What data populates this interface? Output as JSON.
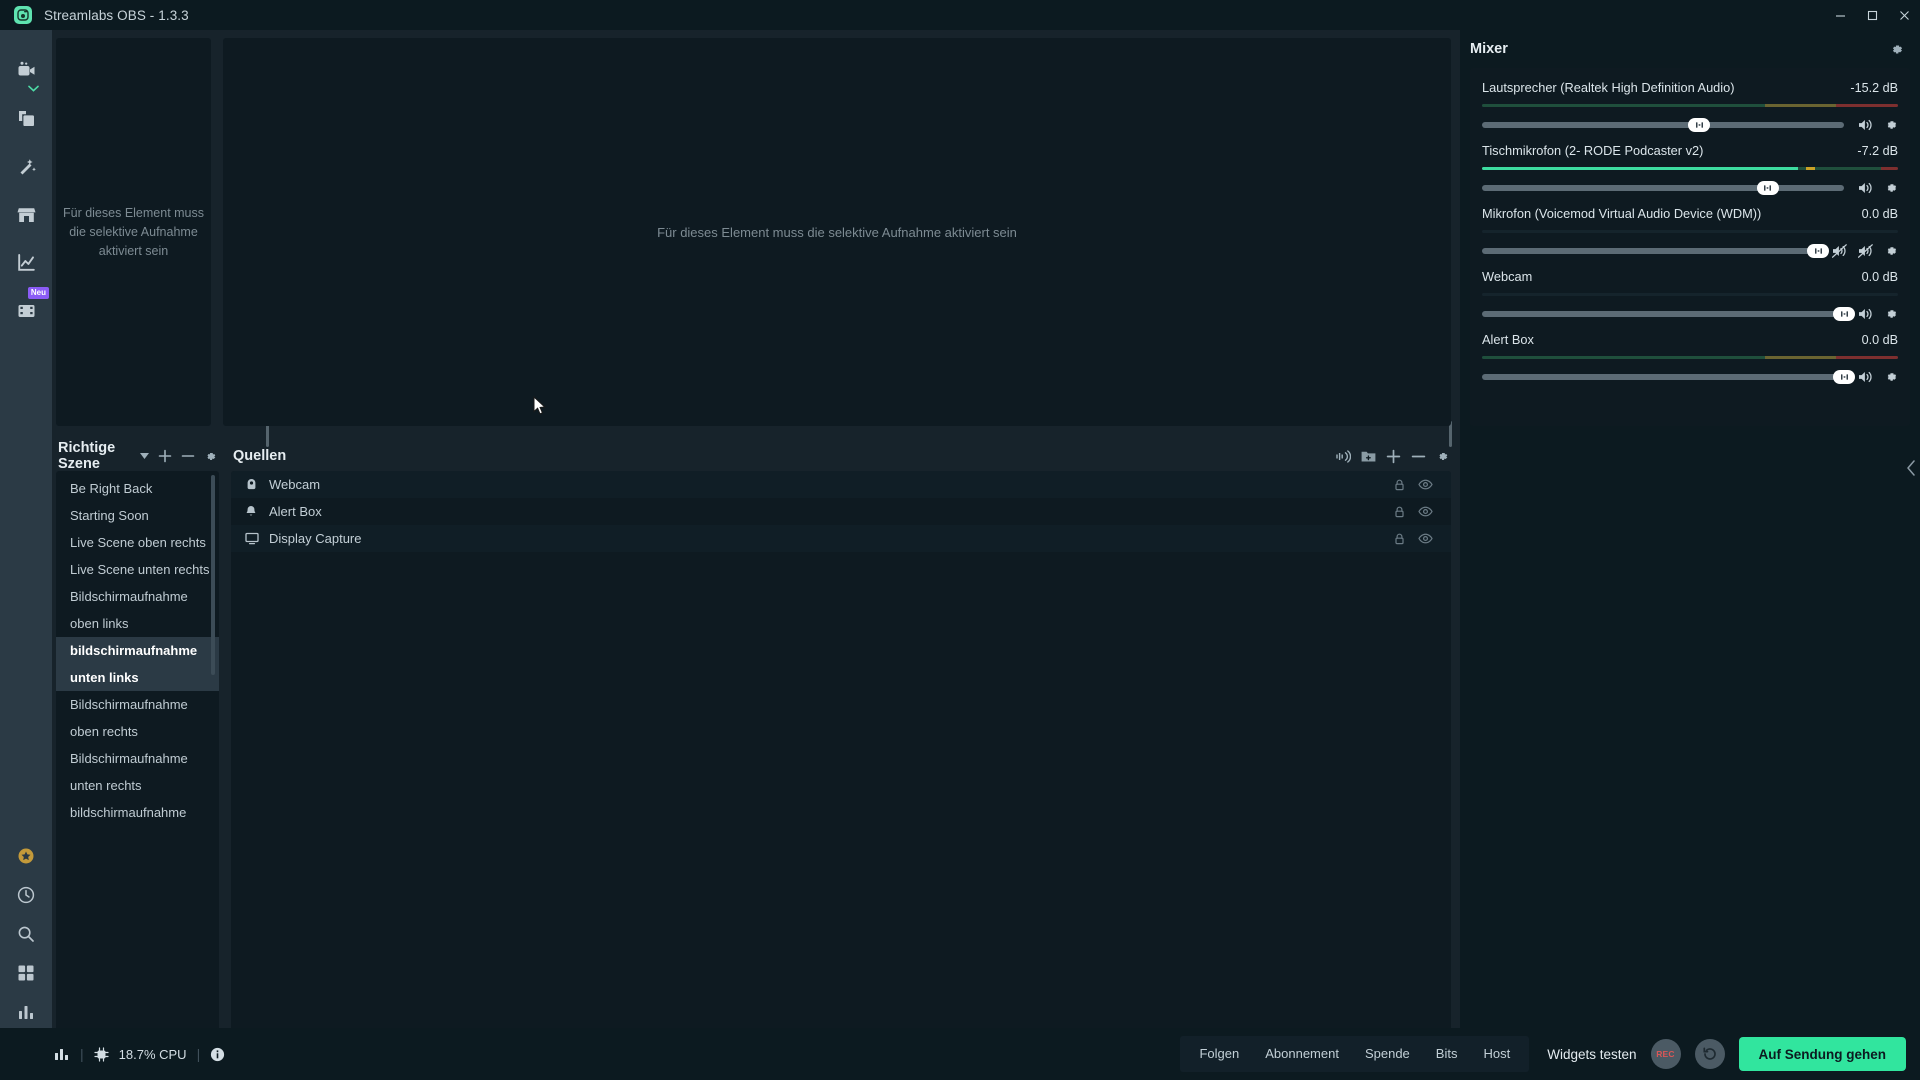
{
  "titlebar": {
    "title": "Streamlabs OBS - 1.3.3",
    "logo_icon": "streamlabs-logo-icon",
    "minimize_label": "–",
    "maximize_label": "□",
    "close_label": "×"
  },
  "rail": {
    "items": [
      {
        "name": "editor",
        "icon": "video-camera-icon",
        "badge": ""
      },
      {
        "name": "themes",
        "icon": "layers-copy-icon",
        "badge": ""
      },
      {
        "name": "alertbox",
        "icon": "magic-wand-icon",
        "badge": ""
      },
      {
        "name": "store",
        "icon": "store-icon",
        "badge": ""
      },
      {
        "name": "dashboard",
        "icon": "chart-line-icon",
        "badge": ""
      },
      {
        "name": "highlighter",
        "icon": "film-icon",
        "badge": "Neu"
      }
    ],
    "bottom_items": [
      {
        "name": "prime",
        "icon": "prime-star-icon"
      },
      {
        "name": "recent-events",
        "icon": "clock-icon"
      },
      {
        "name": "search",
        "icon": "search-icon"
      },
      {
        "name": "layout-editor",
        "icon": "grid-icon"
      },
      {
        "name": "stats",
        "icon": "bars-icon"
      },
      {
        "name": "settings",
        "icon": "gear-icon"
      }
    ]
  },
  "preview": {
    "left_placeholder": "Für dieses Element muss die selektive Aufnahme aktiviert sein",
    "main_placeholder": "Für dieses Element muss die selektive Aufnahme aktiviert sein"
  },
  "scenes": {
    "title": "Richtige Szene",
    "header_icons": [
      "chevron-down-icon",
      "plus-icon",
      "minus-icon",
      "gear-icon"
    ],
    "items": [
      {
        "label": "Be Right Back",
        "selected": false
      },
      {
        "label": "Starting Soon",
        "selected": false
      },
      {
        "label": "Live Scene oben rechts",
        "selected": false
      },
      {
        "label": "Live Scene unten rechts",
        "selected": false
      },
      {
        "label": "Bildschirmaufnahme",
        "selected": false
      },
      {
        "label": "oben links",
        "selected": false
      },
      {
        "label": "bildschirmaufnahme",
        "selected": true
      },
      {
        "label": "unten links",
        "selected": true
      },
      {
        "label": "Bildschirmaufnahme",
        "selected": false
      },
      {
        "label": "oben rechts",
        "selected": false
      },
      {
        "label": "Bildschirmaufnahme",
        "selected": false
      },
      {
        "label": "unten rechts",
        "selected": false
      },
      {
        "label": "bildschirmaufnahme",
        "selected": false
      }
    ]
  },
  "sources": {
    "title": "Quellen",
    "header_icons": [
      "audio-mixer-icon",
      "add-folder-icon",
      "plus-icon",
      "minus-icon",
      "gear-icon"
    ],
    "items": [
      {
        "label": "Webcam",
        "icon": "camera-icon"
      },
      {
        "label": "Alert Box",
        "icon": "bell-icon"
      },
      {
        "label": "Display Capture",
        "icon": "monitor-icon"
      }
    ],
    "row_icons": [
      "lock-icon",
      "eye-icon"
    ]
  },
  "mixer": {
    "title": "Mixer",
    "gear_icon": "gear-icon",
    "channels": [
      {
        "name": "Lautsprecher (Realtek High Definition Audio)",
        "db": "-15.2 dB",
        "meter_pct": 100,
        "meter_style": "idle",
        "volume_pct": 60,
        "muted": false,
        "icons": [
          "volume-icon",
          "gear-icon"
        ]
      },
      {
        "name": "Tischmikrofon (2- RODE Podcaster v2)",
        "db": "-7.2 dB",
        "meter_pct": 76,
        "meter_style": "active",
        "volume_pct": 79,
        "muted": false,
        "icons": [
          "volume-icon",
          "gear-icon"
        ]
      },
      {
        "name": "Mikrofon (Voicemod Virtual Audio Device (WDM))",
        "db": "0.0 dB",
        "meter_pct": 0,
        "meter_style": "none",
        "volume_pct": 100,
        "muted": true,
        "icons": [
          "volume-muted-icon",
          "gear-icon"
        ]
      },
      {
        "name": "Webcam",
        "db": "0.0 dB",
        "meter_pct": 0,
        "meter_style": "none",
        "volume_pct": 100,
        "muted": false,
        "icons": [
          "volume-icon",
          "gear-icon"
        ]
      },
      {
        "name": "Alert Box",
        "db": "0.0 dB",
        "meter_pct": 100,
        "meter_style": "idle",
        "volume_pct": 100,
        "muted": false,
        "icons": [
          "volume-icon",
          "gear-icon"
        ]
      }
    ]
  },
  "statusbar": {
    "perf_icon": "bars-icon",
    "cpu_icon": "cpu-icon",
    "cpu": "18.7% CPU",
    "info_icon": "info-icon",
    "separator": "|",
    "tabs": [
      "Folgen",
      "Abonnement",
      "Spende",
      "Bits",
      "Host"
    ],
    "widgets_label": "Widgets testen",
    "rec_label": "REC",
    "replay_icon": "replay-icon",
    "golive_label": "Auf Sendung gehen"
  },
  "colors": {
    "accent_green": "#31e59e",
    "rail_bg": "#2b3a45",
    "panel_bg": "#0e1a21",
    "app_bg": "#17232b"
  }
}
